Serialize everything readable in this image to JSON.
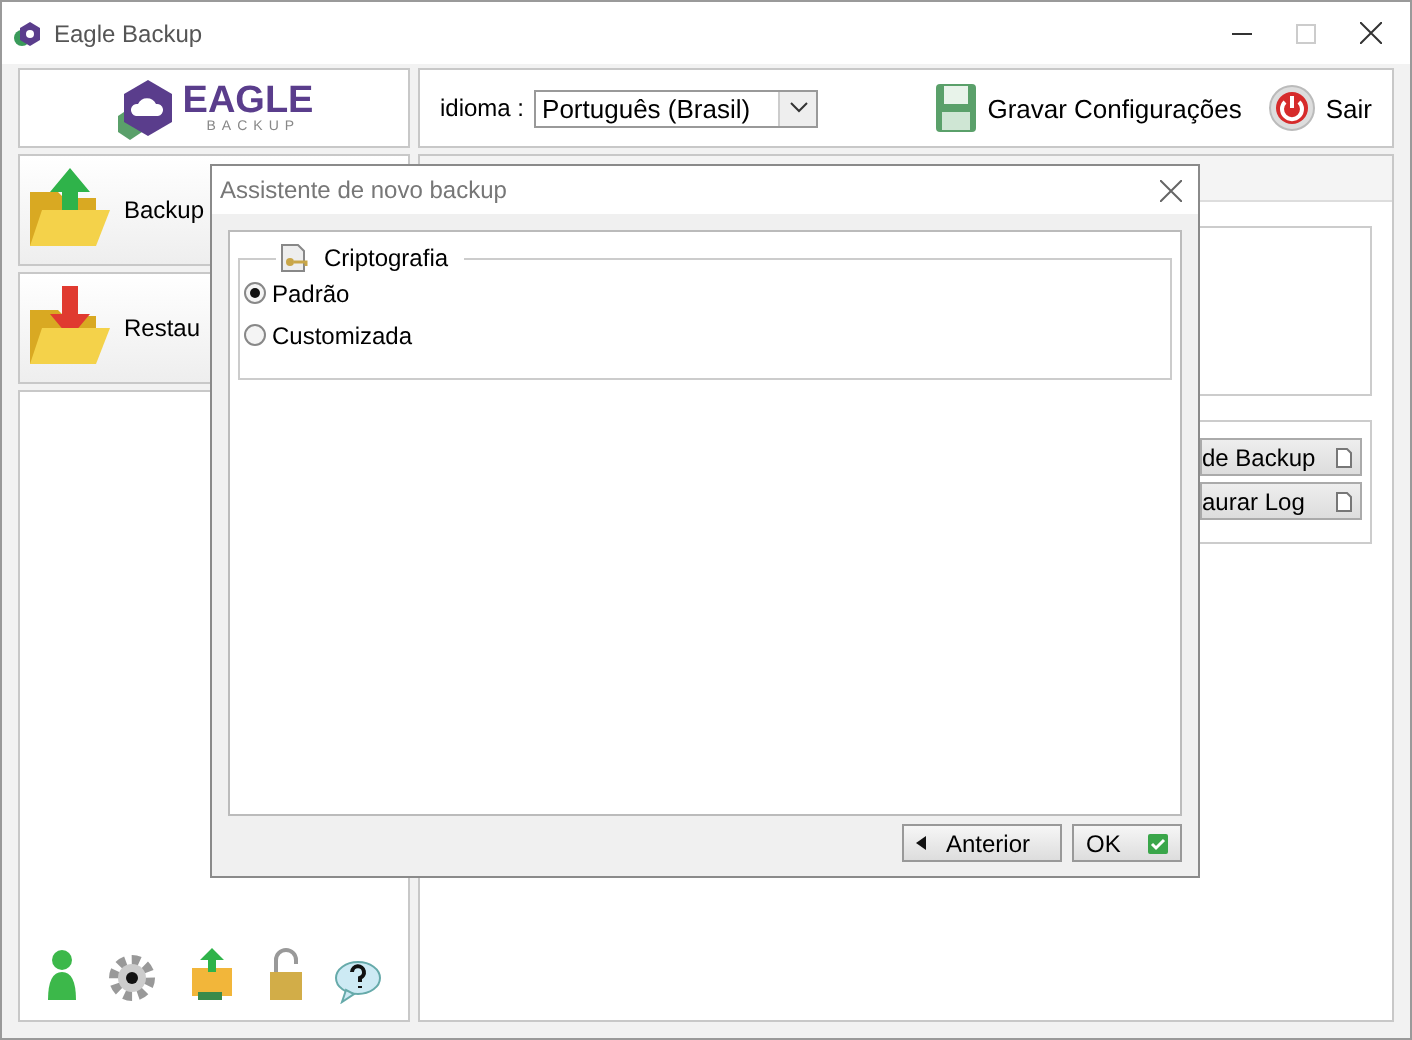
{
  "window": {
    "title": "Eagle Backup"
  },
  "logo": {
    "name": "EAGLE",
    "tagline": "BACKUP"
  },
  "toolbar": {
    "language_label": "idioma :",
    "language": "Português (Brasil)",
    "buttons": [
      {
        "label": "Gravar Configurações",
        "kind": "save"
      },
      {
        "label": "Sair",
        "kind": "exit"
      }
    ]
  },
  "sidebar": {
    "items": [
      {
        "label": "Backup",
        "kind": "backup"
      },
      {
        "label": "Restau",
        "kind": "restore"
      }
    ]
  },
  "main": {
    "buttons": [
      "de Backup",
      "aurar Log"
    ]
  },
  "dialog": {
    "title": "Assistente de novo backup",
    "group": {
      "title": "Criptografia",
      "options": [
        {
          "label": "Padrão",
          "selected": true
        },
        {
          "label": "Customizada",
          "selected": false
        }
      ]
    },
    "buttons": [
      {
        "label": "Anterior",
        "kind": "back"
      },
      {
        "label": "OK",
        "kind": "ok"
      }
    ]
  }
}
